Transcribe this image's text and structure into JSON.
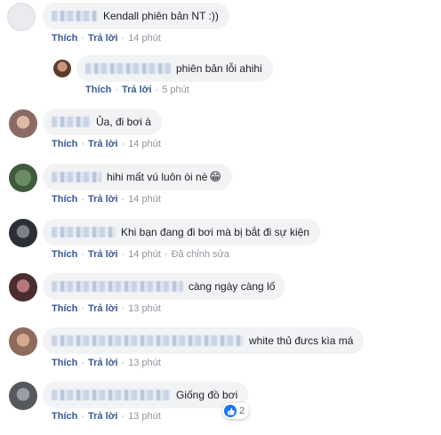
{
  "comments": [
    {
      "text": "Kendall phiên bản NT :))",
      "like": "Thích",
      "reply": "Trả lời",
      "time": "14 phút"
    },
    {
      "text": "phiên bản lỗi ahihi",
      "like": "Thích",
      "reply": "Trả lời",
      "time": "5 phút"
    },
    {
      "text": "Ủa, đi bơi à",
      "like": "Thích",
      "reply": "Trả lời",
      "time": "14 phút"
    },
    {
      "text": "hihi mất vú luôn òi nè",
      "emoji": "😁",
      "like": "Thích",
      "reply": "Trả lời",
      "time": "14 phút"
    },
    {
      "text": "Khi bạn đang đi bơi mà bị bắt đi sự kiện",
      "like": "Thích",
      "reply": "Trả lời",
      "time": "14 phút",
      "edited": "Đã chỉnh sửa"
    },
    {
      "text": "càng ngày càng lố",
      "like": "Thích",
      "reply": "Trả lời",
      "time": "13 phút"
    },
    {
      "text": "white thủ đưcs kìa má",
      "like": "Thích",
      "reply": "Trả lời",
      "time": "13 phút"
    },
    {
      "text": "Giống đồ bơi",
      "like": "Thích",
      "reply": "Trả lời",
      "time": "13 phút",
      "reaction_count": "2"
    }
  ],
  "colors": {
    "link": "#385898",
    "meta": "#90949c",
    "bubble": "#f2f3f5",
    "like_icon": "#1877f2"
  }
}
